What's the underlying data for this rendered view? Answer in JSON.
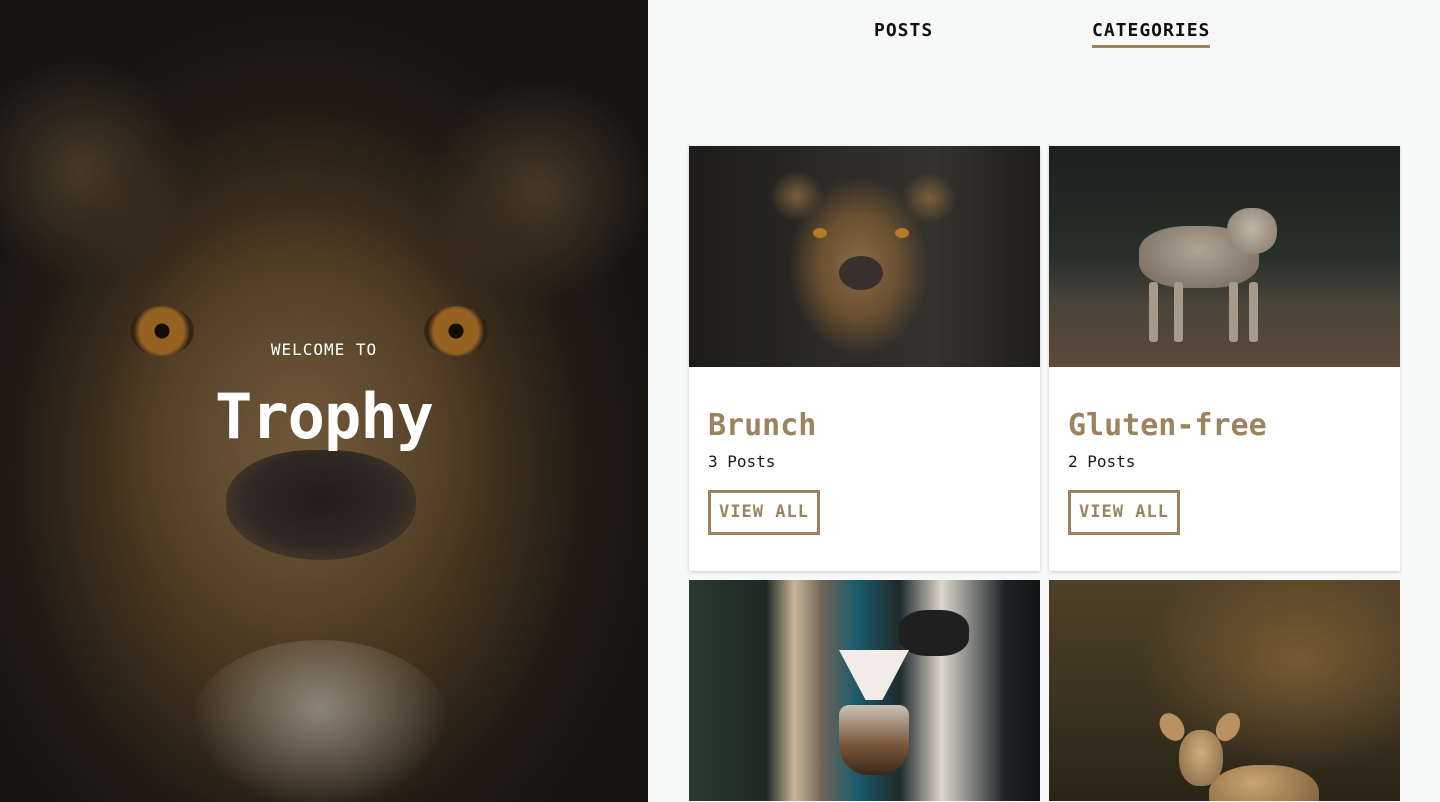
{
  "hero": {
    "welcome": "WELCOME TO",
    "brand": "Trophy",
    "image": "lioness-photo"
  },
  "nav": {
    "items": [
      {
        "label": "POSTS",
        "active": false
      },
      {
        "label": "CATEGORIES",
        "active": true
      }
    ]
  },
  "categories": [
    {
      "title": "Brunch",
      "count": "3 Posts",
      "button": "VIEW ALL",
      "image": "lioness-photo"
    },
    {
      "title": "Gluten-free",
      "count": "2 Posts",
      "button": "VIEW ALL",
      "image": "coyote-photo"
    },
    {
      "image": "coffee-brewing-photo"
    },
    {
      "image": "deer-photo"
    }
  ],
  "colors": {
    "accent": "#9c8460",
    "background": "#f7f8f8",
    "card": "#ffffff",
    "text": "#111111"
  }
}
